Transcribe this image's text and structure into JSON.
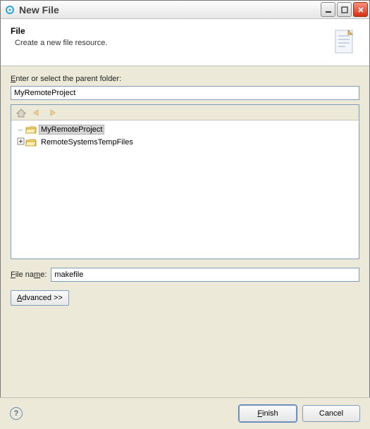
{
  "window": {
    "title": "New File"
  },
  "banner": {
    "title": "File",
    "subtitle": "Create a new file resource."
  },
  "form": {
    "parent_label": "Enter or select the parent folder:",
    "parent_value": "MyRemoteProject",
    "filename_label": "File name:",
    "filename_value": "makefile",
    "advanced_label": "Advanced >>"
  },
  "tree": {
    "items": [
      {
        "label": "MyRemoteProject",
        "selected": true,
        "expandable": false
      },
      {
        "label": "RemoteSystemsTempFiles",
        "selected": false,
        "expandable": true
      }
    ]
  },
  "buttons": {
    "finish": "Finish",
    "cancel": "Cancel"
  }
}
